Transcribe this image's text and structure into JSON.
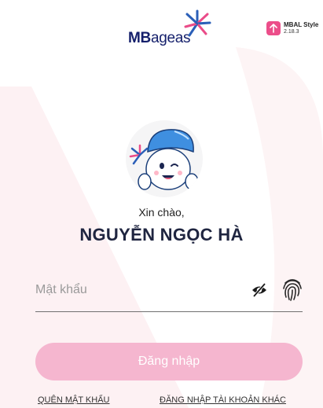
{
  "header": {
    "logo": {
      "brand_bold": "MB",
      "brand_light": "ageas",
      "icon": "mb-ageas-star-logo"
    },
    "version_badge": {
      "icon": "arrow-up-icon",
      "name": "MBAL Style",
      "number": "2.18.3",
      "color": "#ec4e8a"
    }
  },
  "profile": {
    "avatar_icon": "mascot-avatar",
    "greeting": "Xin chào,",
    "name": "NGUYỄN NGỌC HÀ"
  },
  "login_form": {
    "password_placeholder": "Mật khẩu",
    "toggle_visibility_icon": "eye-slash-icon",
    "biometric_icon": "fingerprint-icon",
    "login_button": "Đăng nhập"
  },
  "links": {
    "forgot_password": "QUÊN MẬT KHẨU",
    "other_account": "ĐĂNG NHẬP TÀI KHOẢN KHÁC"
  },
  "colors": {
    "brand_navy": "#141f6b",
    "accent_pink": "#ec4e8a",
    "button_pink_disabled": "#f5b6cf"
  }
}
